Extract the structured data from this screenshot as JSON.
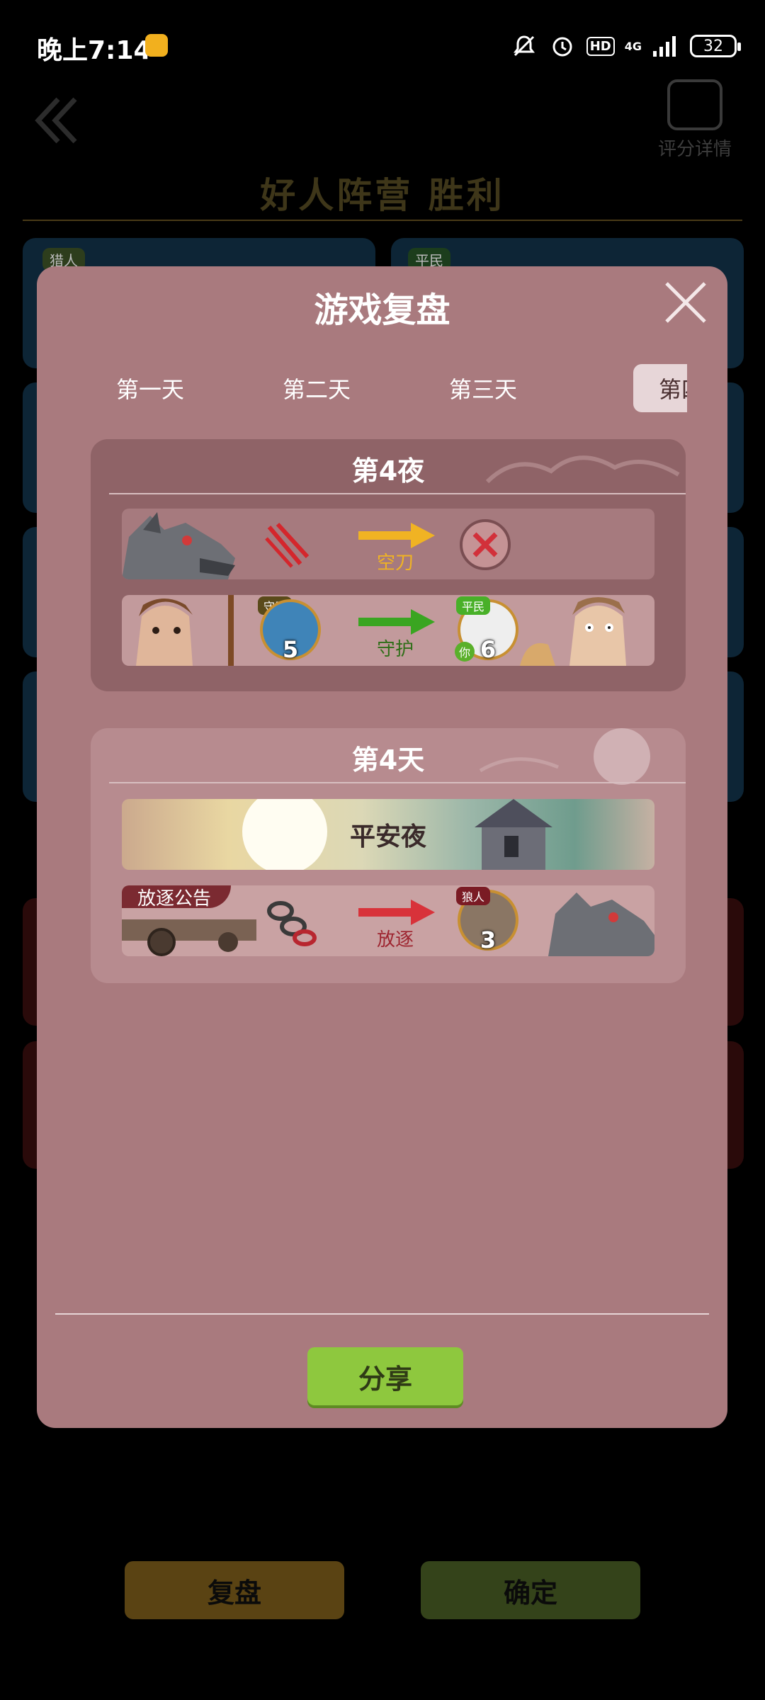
{
  "status_bar": {
    "time": "晚上7:14",
    "hd": "HD",
    "network": "4G",
    "battery": "32"
  },
  "background": {
    "detail_label": "评分详情",
    "result_title": "好人阵营  胜利",
    "tag_left": "猎人",
    "tag_right": "平民",
    "replay_button": "复盘",
    "confirm_button": "确定"
  },
  "modal": {
    "title": "游戏复盘",
    "tabs": [
      "第一天",
      "第二天",
      "第三天",
      "第四天"
    ],
    "active_tab_index": 3,
    "night_panel": {
      "title": "第4夜",
      "rows": [
        {
          "action": "空刀"
        },
        {
          "actor_role": "守卫",
          "actor_seat": "5",
          "action": "守护",
          "target_role": "平民",
          "target_seat": "6",
          "you": "你"
        }
      ]
    },
    "day_panel": {
      "title": "第4天",
      "peace": "平安夜",
      "exile": {
        "banner": "放逐公告",
        "action": "放逐",
        "target_role": "狼人",
        "target_seat": "3"
      }
    },
    "share_button": "分享"
  },
  "colors": {
    "modal_bg": "#a97a7e",
    "share_green": "#8ec83e",
    "arrow_yellow": "#f0b323",
    "arrow_green": "#3aa521",
    "arrow_red": "#d8323a"
  }
}
